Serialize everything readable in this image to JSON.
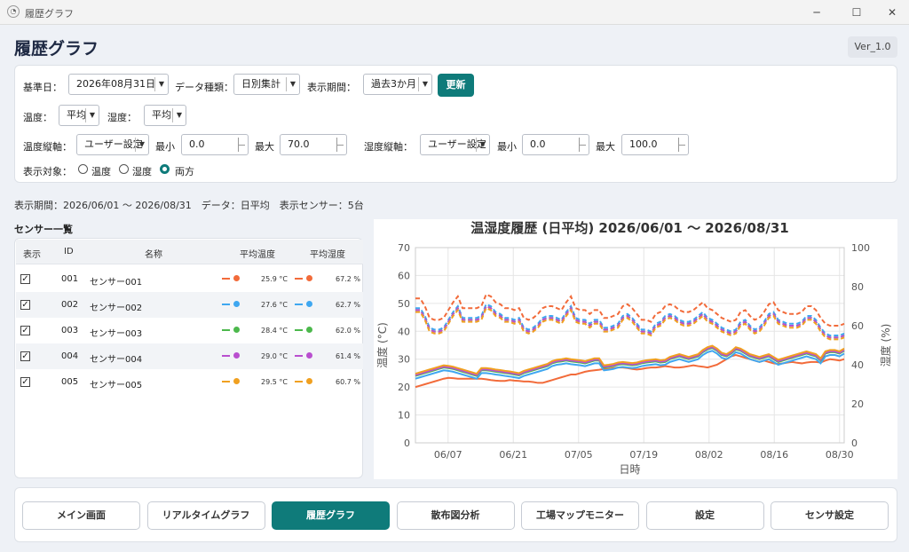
{
  "window": {
    "title": "履歴グラフ",
    "minimize": "─",
    "maximize": "☐",
    "close": "✕"
  },
  "header": {
    "title": "履歴グラフ",
    "version": "Ver_1.0"
  },
  "filters": {
    "base_date_label": "基準日：",
    "base_date": "2026年08月31日",
    "data_type_label": "データ種類：",
    "data_type": "日別集計",
    "period_label": "表示期間：",
    "period": "過去3か月",
    "update": "更新",
    "temp_label": "温度：",
    "temp_mode": "平均",
    "hum_label": "湿度：",
    "hum_mode": "平均",
    "temp_axis_label": "温度縦軸：",
    "temp_axis": "ユーザー設定",
    "temp_min_label": "最小",
    "temp_min": "0.0",
    "temp_max_label": "最大",
    "temp_max": "70.0",
    "hum_axis_label": "湿度縦軸：",
    "hum_axis": "ユーザー設定",
    "hum_min_label": "最小",
    "hum_min": "0.0",
    "hum_max_label": "最大",
    "hum_max": "100.0",
    "target_label": "表示対象：",
    "targets": [
      "温度",
      "湿度",
      "両方"
    ],
    "target_selected": "両方"
  },
  "status": "表示期間：2026/06/01 〜 2026/08/31　データ：日平均　表示センサー：5台",
  "sensor_list": {
    "title": "センサー一覧",
    "columns": [
      "表示",
      "ID",
      "名称",
      "平均温度",
      "平均湿度"
    ],
    "rows": [
      {
        "checked": "✓",
        "id": "001",
        "name": "センサー001",
        "temp": "25.9 °C",
        "hum": "67.2 %",
        "color": "#f26b3a"
      },
      {
        "checked": "✓",
        "id": "002",
        "name": "センサー002",
        "temp": "27.6 °C",
        "hum": "62.7 %",
        "color": "#3fa7f0"
      },
      {
        "checked": "✓",
        "id": "003",
        "name": "センサー003",
        "temp": "28.4 °C",
        "hum": "62.0 %",
        "color": "#4cb84c"
      },
      {
        "checked": "✓",
        "id": "004",
        "name": "センサー004",
        "temp": "29.0 °C",
        "hum": "61.4 %",
        "color": "#b94fcf"
      },
      {
        "checked": "✓",
        "id": "005",
        "name": "センサー005",
        "temp": "29.5 °C",
        "hum": "60.7 %",
        "color": "#f0a020"
      }
    ]
  },
  "chart_data": {
    "type": "line",
    "title": "温湿度履歴 (日平均) 2026/06/01 〜 2026/08/31",
    "xlabel": "日時",
    "ylabel_left": "温度 (°C)",
    "ylabel_right": "湿度 (%)",
    "ylim_left": [
      0,
      70
    ],
    "ylim_right": [
      0,
      100
    ],
    "yticks_left": [
      0,
      10,
      20,
      30,
      40,
      50,
      60,
      70
    ],
    "yticks_right": [
      0,
      20,
      40,
      60,
      80,
      100
    ],
    "xticks": [
      "06/07",
      "06/21",
      "07/05",
      "07/19",
      "08/02",
      "08/16",
      "08/30"
    ],
    "xstart": "2026-05-31",
    "xend": "2026-08-31",
    "grid": true,
    "humidity_series": [
      {
        "name": "センサー001",
        "color": "#f26b3a",
        "values": [
          74,
          74,
          70,
          64,
          63,
          63,
          64,
          68,
          72,
          75,
          69,
          69,
          69,
          69,
          70,
          76,
          75,
          72,
          71,
          69,
          69,
          68,
          69,
          64,
          63,
          64,
          66,
          69,
          70,
          70,
          69,
          68,
          72,
          75,
          69,
          68,
          68,
          66,
          68,
          68,
          64,
          64,
          65,
          66,
          70,
          71,
          69,
          66,
          63,
          63,
          62,
          66,
          67,
          70,
          71,
          70,
          68,
          67,
          67,
          68,
          70,
          72,
          69,
          68,
          66,
          64,
          63,
          62,
          63,
          67,
          68,
          65,
          63,
          64,
          67,
          71,
          72,
          68,
          67,
          66,
          66,
          66,
          67,
          70,
          70,
          68,
          64,
          61,
          60,
          60,
          60,
          61
        ]
      },
      {
        "name": "センサー002",
        "color": "#3fa7f0",
        "values": [
          69,
          69,
          65,
          59,
          58,
          58,
          59,
          63,
          67,
          70,
          64,
          64,
          64,
          64,
          65,
          71,
          70,
          67,
          66,
          64,
          64,
          63,
          64,
          59,
          58,
          59,
          61,
          64,
          65,
          65,
          64,
          63,
          67,
          70,
          64,
          63,
          63,
          61,
          63,
          63,
          59,
          59,
          60,
          61,
          65,
          66,
          64,
          61,
          58,
          58,
          57,
          61,
          62,
          65,
          66,
          65,
          63,
          62,
          62,
          63,
          65,
          67,
          64,
          63,
          61,
          59,
          58,
          57,
          58,
          62,
          63,
          60,
          58,
          59,
          62,
          66,
          67,
          63,
          62,
          61,
          61,
          61,
          62,
          65,
          65,
          63,
          59,
          56,
          55,
          55,
          55,
          56
        ]
      },
      {
        "name": "センサー003",
        "color": "#4cb84c",
        "values": [
          68,
          68,
          64,
          58,
          57,
          57,
          58,
          62,
          66,
          69,
          63,
          63,
          63,
          63,
          64,
          70,
          69,
          66,
          65,
          63,
          63,
          62,
          63,
          58,
          57,
          58,
          60,
          63,
          64,
          64,
          63,
          62,
          66,
          69,
          63,
          62,
          62,
          60,
          62,
          62,
          58,
          58,
          59,
          60,
          64,
          65,
          63,
          60,
          57,
          57,
          56,
          60,
          61,
          64,
          65,
          64,
          62,
          61,
          61,
          62,
          64,
          66,
          63,
          62,
          60,
          58,
          57,
          56,
          57,
          61,
          62,
          59,
          57,
          58,
          61,
          65,
          66,
          62,
          61,
          60,
          60,
          60,
          61,
          64,
          64,
          62,
          58,
          55,
          54,
          54,
          54,
          55
        ]
      },
      {
        "name": "センサー004",
        "color": "#b94fcf",
        "values": [
          68,
          68,
          64,
          58,
          57,
          57,
          58,
          62,
          66,
          69,
          63,
          63,
          63,
          63,
          64,
          70,
          69,
          66,
          65,
          63,
          63,
          62,
          63,
          58,
          57,
          58,
          60,
          63,
          64,
          64,
          63,
          62,
          66,
          69,
          63,
          62,
          62,
          60,
          62,
          62,
          58,
          58,
          59,
          60,
          64,
          65,
          63,
          60,
          57,
          57,
          56,
          60,
          61,
          64,
          65,
          64,
          62,
          61,
          61,
          62,
          64,
          66,
          63,
          62,
          60,
          58,
          57,
          56,
          57,
          61,
          62,
          59,
          57,
          58,
          61,
          65,
          66,
          62,
          61,
          60,
          60,
          60,
          61,
          64,
          64,
          62,
          58,
          55,
          54,
          54,
          54,
          55
        ]
      },
      {
        "name": "センサー005",
        "color": "#f0a020",
        "values": [
          67,
          67,
          63,
          57,
          56,
          56,
          57,
          61,
          65,
          68,
          62,
          62,
          62,
          62,
          63,
          69,
          68,
          65,
          64,
          62,
          62,
          61,
          62,
          57,
          56,
          57,
          59,
          62,
          63,
          63,
          62,
          61,
          65,
          68,
          62,
          61,
          61,
          59,
          61,
          61,
          57,
          57,
          58,
          59,
          63,
          64,
          62,
          59,
          56,
          56,
          55,
          59,
          60,
          63,
          64,
          63,
          61,
          60,
          60,
          61,
          63,
          65,
          62,
          61,
          59,
          57,
          56,
          55,
          56,
          60,
          61,
          58,
          56,
          57,
          60,
          64,
          65,
          61,
          60,
          59,
          59,
          59,
          60,
          63,
          63,
          61,
          57,
          54,
          53,
          53,
          53,
          54
        ]
      }
    ],
    "temperature_series": [
      {
        "name": "センサー001",
        "color": "#f26b3a",
        "values": [
          20,
          20.5,
          21,
          21.5,
          22,
          22.5,
          23,
          23.3,
          23.2,
          23,
          23,
          23,
          23,
          23,
          23,
          22.8,
          22.5,
          22.3,
          22.2,
          22.2,
          22.5,
          22.3,
          22.2,
          22,
          22,
          21.8,
          21.5,
          21.5,
          22,
          22.5,
          23,
          23.5,
          24,
          24.5,
          24.5,
          25,
          25.5,
          25.8,
          26,
          26.2,
          26.5,
          26.5,
          26.8,
          27,
          27,
          26.8,
          26.5,
          26.3,
          26.5,
          26.8,
          27,
          27,
          27.2,
          27.5,
          27.3,
          27,
          27,
          27.2,
          27.5,
          27.8,
          27.5,
          27.3,
          27,
          27.5,
          28,
          29,
          30,
          31,
          31.5,
          31,
          30.5,
          30,
          29.5,
          29,
          29.5,
          29,
          28.5,
          28.3,
          28.5,
          28.8,
          29,
          28.7,
          28.5,
          28.8,
          29,
          29,
          28.8,
          29.5,
          30,
          29.8,
          29.5,
          30
        ]
      },
      {
        "name": "センサー002",
        "color": "#3fa7f0",
        "values": [
          23,
          23.5,
          24,
          24.5,
          25,
          25.5,
          26,
          25.8,
          25.5,
          25,
          24.5,
          24,
          23.5,
          23,
          25,
          25,
          24.8,
          24.5,
          24.3,
          24,
          23.8,
          23.5,
          23.2,
          24,
          24.5,
          25,
          25.5,
          26,
          26.5,
          27.5,
          28,
          28.2,
          28.5,
          28.2,
          28,
          27.8,
          27.5,
          28,
          28.5,
          28.5,
          26,
          26.2,
          26.5,
          27,
          27.2,
          27,
          26.8,
          27,
          27.5,
          27.8,
          28,
          28.2,
          27.8,
          28,
          29,
          29.5,
          30,
          29.5,
          29,
          29.5,
          30,
          31.5,
          32.5,
          33,
          32,
          30.5,
          30,
          31,
          32.5,
          32,
          31,
          30,
          29.5,
          29,
          29.5,
          30,
          29,
          28,
          28.5,
          29,
          29.5,
          30,
          30.5,
          31,
          30.5,
          30,
          28.5,
          31,
          31.5,
          31.5,
          31,
          32
        ]
      },
      {
        "name": "センサー003",
        "color": "#4cb84c",
        "values": [
          24,
          24.5,
          25,
          25.5,
          26,
          26.5,
          27,
          26.8,
          26.5,
          26,
          25.5,
          25,
          24.5,
          24,
          26,
          26,
          25.8,
          25.5,
          25.3,
          25,
          24.8,
          24.5,
          24.2,
          25,
          25.5,
          26,
          26.5,
          27,
          27.5,
          28.5,
          29,
          29.2,
          29.5,
          29.2,
          29,
          28.8,
          28.5,
          29,
          29.5,
          29.5,
          27,
          27.2,
          27.5,
          28,
          28.2,
          28,
          27.8,
          28,
          28.5,
          28.8,
          29,
          29.2,
          28.8,
          29,
          30,
          30.5,
          31,
          30.5,
          30,
          30.5,
          31,
          32.5,
          33.5,
          34,
          33,
          31.5,
          31,
          32,
          33.5,
          33,
          32,
          31,
          30.5,
          30,
          30.5,
          31,
          30,
          29,
          29.5,
          30,
          30.5,
          31,
          31.5,
          32,
          31.5,
          31,
          29.5,
          32,
          32.5,
          32.5,
          32,
          33
        ]
      },
      {
        "name": "センサー004",
        "color": "#b94fcf",
        "values": [
          24.3,
          24.8,
          25.3,
          25.8,
          26.3,
          26.8,
          27.3,
          27.1,
          26.8,
          26.3,
          25.8,
          25.3,
          24.8,
          24.3,
          26.3,
          26.3,
          26.1,
          25.8,
          25.6,
          25.3,
          25.1,
          24.8,
          24.5,
          25.3,
          25.8,
          26.3,
          26.8,
          27.3,
          27.8,
          28.8,
          29.3,
          29.5,
          29.8,
          29.5,
          29.3,
          29.1,
          28.8,
          29.3,
          29.8,
          29.8,
          27.3,
          27.5,
          27.8,
          28.3,
          28.5,
          28.3,
          28.1,
          28.3,
          28.8,
          29.1,
          29.3,
          29.5,
          29.1,
          29.3,
          30.3,
          30.8,
          31.3,
          30.8,
          30.3,
          30.8,
          31.3,
          32.8,
          33.8,
          34.3,
          33.3,
          31.8,
          31.3,
          32.3,
          33.8,
          33.3,
          32.3,
          31.3,
          30.8,
          30.3,
          30.8,
          31.3,
          30.3,
          29.3,
          29.8,
          30.3,
          30.8,
          31.3,
          31.8,
          32.3,
          31.8,
          31.3,
          29.8,
          32.3,
          32.8,
          32.8,
          32.3,
          33.3
        ]
      },
      {
        "name": "センサー005",
        "color": "#f0a020",
        "values": [
          24.8,
          25.3,
          25.8,
          26.3,
          26.8,
          27.3,
          27.8,
          27.6,
          27.3,
          26.8,
          26.3,
          25.8,
          25.3,
          24.8,
          26.8,
          26.8,
          26.6,
          26.3,
          26.1,
          25.8,
          25.6,
          25.3,
          25,
          25.8,
          26.3,
          26.8,
          27.3,
          27.8,
          28.3,
          29.3,
          29.8,
          30,
          30.3,
          30,
          29.8,
          29.6,
          29.3,
          29.8,
          30.3,
          30.3,
          27.8,
          28,
          28.3,
          28.8,
          29,
          28.8,
          28.6,
          28.8,
          29.3,
          29.6,
          29.8,
          30,
          29.6,
          29.8,
          30.8,
          31.3,
          31.8,
          31.3,
          30.8,
          31.3,
          31.8,
          33.3,
          34.3,
          34.8,
          33.8,
          32.3,
          31.8,
          32.8,
          34.3,
          33.8,
          32.8,
          31.8,
          31.3,
          30.8,
          31.3,
          31.8,
          30.8,
          29.8,
          30.3,
          30.8,
          31.3,
          31.8,
          32.3,
          32.8,
          32.3,
          31.8,
          30.3,
          32.8,
          33.3,
          33.3,
          32.8,
          33.8
        ]
      }
    ]
  },
  "nav": [
    "メイン画面",
    "リアルタイムグラフ",
    "履歴グラフ",
    "散布図分析",
    "工場マップモニター",
    "設定",
    "センサ設定"
  ],
  "nav_active": "履歴グラフ"
}
